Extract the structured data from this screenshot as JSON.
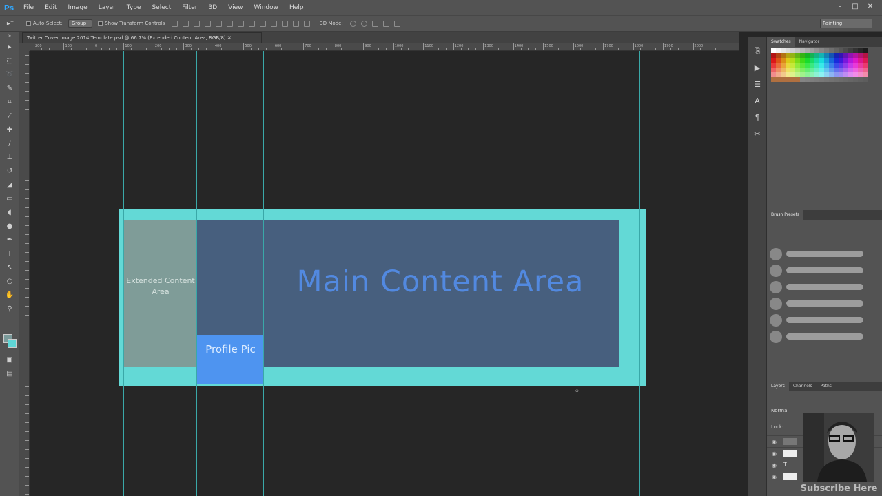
{
  "app": {
    "logo": "Ps"
  },
  "menubar": {
    "items": [
      "File",
      "Edit",
      "Image",
      "Layer",
      "Type",
      "Select",
      "Filter",
      "3D",
      "View",
      "Window",
      "Help"
    ],
    "window_buttons": [
      "–",
      "□",
      "✕"
    ]
  },
  "options_bar": {
    "auto_select_label": "Auto-Select:",
    "auto_select_value": "Group",
    "show_transform_label": "Show Transform Controls",
    "mode_label": "3D Mode:",
    "workspace": "Painting"
  },
  "document": {
    "tab_title": "Twitter Cover Image 2014 Template.psd @ 66.7% (Extended Content Area, RGB/8) ✕"
  },
  "ruler": {
    "labels": [
      "200",
      "100",
      "0",
      "100",
      "200",
      "300",
      "400",
      "500",
      "600",
      "700",
      "800",
      "900",
      "1000",
      "1100",
      "1200",
      "1300",
      "1400",
      "1500",
      "1600",
      "1700",
      "1800",
      "1900",
      "2000"
    ]
  },
  "canvas": {
    "extended_label": "Extended Content Area",
    "profile_label": "Profile Pic",
    "main_label": "Main Content Area"
  },
  "panels": {
    "swatches_tabs": [
      "Swatches",
      "Navigator"
    ],
    "brush_tabs": [
      "Brush Presets"
    ],
    "layer_tabs": [
      "Layers",
      "Channels",
      "Paths"
    ],
    "blend_mode": "Normal",
    "lock_label": "Lock:"
  },
  "overlay": {
    "subscribe": "Subscribe Here"
  },
  "colors": {
    "frame": "#63d9d6",
    "main_area": "#465c7b",
    "extended_area": "#7f9c98",
    "profile": "#4e94f0",
    "guide": "#3aa8a8",
    "main_text": "#5289e0"
  }
}
